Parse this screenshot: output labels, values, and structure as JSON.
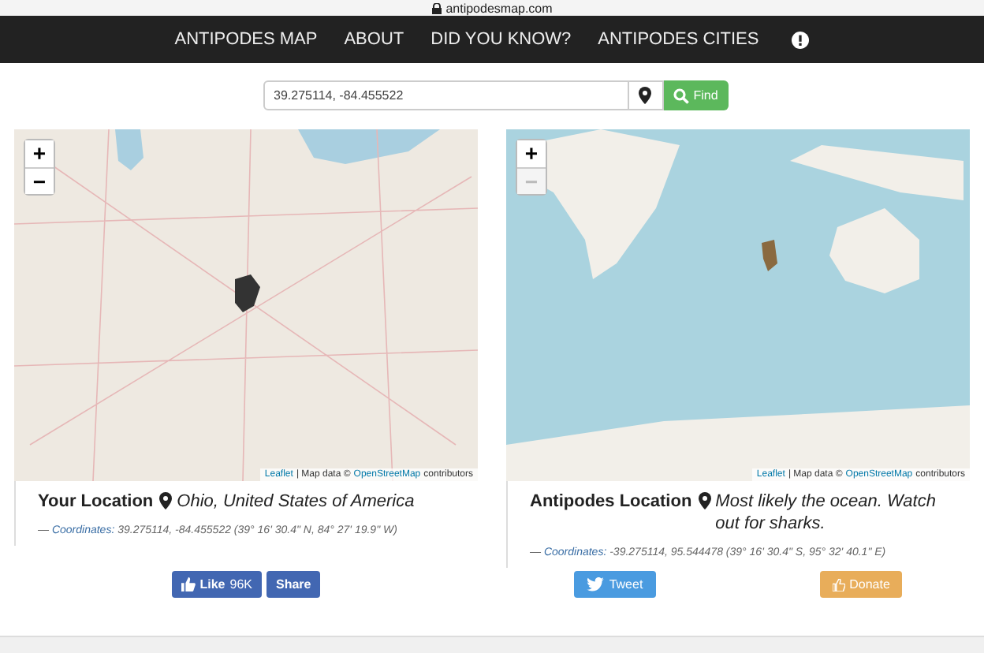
{
  "browser": {
    "url": "antipodesmap.com"
  },
  "nav": {
    "items": [
      "ANTIPODES MAP",
      "ABOUT",
      "DID YOU KNOW?",
      "ANTIPODES CITIES"
    ]
  },
  "search": {
    "value": "39.275114, -84.455522",
    "button": "Find"
  },
  "maps": [
    {
      "kind": "land",
      "zoom_in": "+",
      "zoom_out": "−",
      "zoom_out_disabled": false,
      "attribution": {
        "leaflet": "Leaflet",
        "data": "| Map data ©",
        "osm": "OpenStreetMap",
        "end": "contributors"
      }
    },
    {
      "kind": "ocean",
      "zoom_in": "+",
      "zoom_out": "−",
      "zoom_out_disabled": true,
      "attribution": {
        "leaflet": "Leaflet",
        "data": "| Map data ©",
        "osm": "OpenStreetMap",
        "end": "contributors"
      }
    }
  ],
  "locations": [
    {
      "label": "Your Location",
      "place": "Ohio, United States of America",
      "dash": "—",
      "coord_label": "Coordinates:",
      "coords": "39.275114, -84.455522 (39° 16' 30.4\" N, 84° 27' 19.9\" W)"
    },
    {
      "label": "Antipodes Location",
      "place": "Most likely the ocean. Watch out for sharks.",
      "dash": "—",
      "coord_label": "Coordinates:",
      "coords": "-39.275114, 95.544478 (39° 16' 30.4\" S, 95° 32' 40.1\" E)"
    }
  ],
  "social": {
    "like": "Like",
    "like_count": "96K",
    "share": "Share",
    "tweet": "Tweet",
    "donate": "Donate"
  }
}
